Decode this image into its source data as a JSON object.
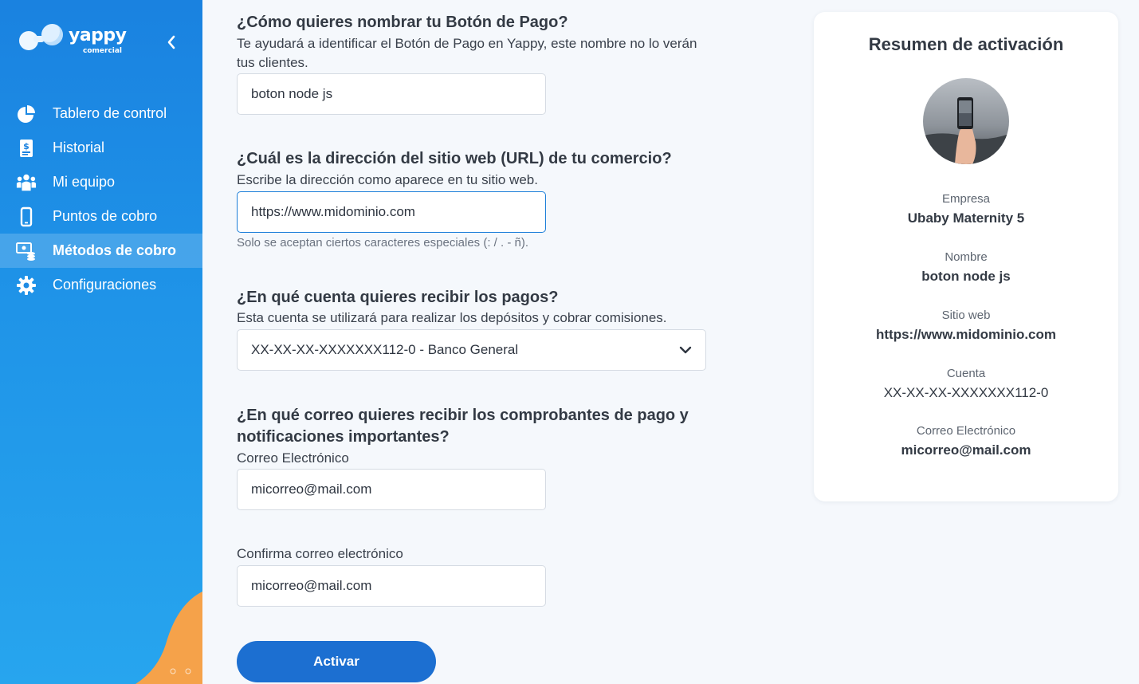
{
  "brand": {
    "name": "yappy",
    "sub": "comercial"
  },
  "sidebar": {
    "items": [
      {
        "label": "Tablero de control",
        "icon": "pie-chart-icon"
      },
      {
        "label": "Historial",
        "icon": "receipt-icon"
      },
      {
        "label": "Mi equipo",
        "icon": "team-icon"
      },
      {
        "label": "Puntos de cobro",
        "icon": "phone-icon"
      },
      {
        "label": "Métodos de cobro",
        "icon": "payment-methods-icon",
        "active": true
      },
      {
        "label": "Configuraciones",
        "icon": "gear-icon"
      }
    ]
  },
  "form": {
    "q1": {
      "title": "¿Cómo quieres nombrar tu Botón de Pago?",
      "desc_line1": "Te ayudará a identificar el Botón de Pago en Yappy, este nombre no lo verán",
      "desc_line2": "tus clientes.",
      "value": "boton node js"
    },
    "q2": {
      "title": "¿Cuál es la dirección del sitio web (URL) de tu comercio?",
      "desc": "Escribe la dirección como aparece en tu sitio web.",
      "value": "https://www.midominio.com",
      "hint": "Solo se aceptan ciertos caracteres especiales (: / . - ñ)."
    },
    "q3": {
      "title": "¿En qué cuenta quieres recibir los pagos?",
      "desc": "Esta cuenta se utilizará para realizar los depósitos y cobrar comisiones.",
      "selected": "XX-XX-XX-XXXXXXX112-0 - Banco General"
    },
    "q4": {
      "title_line1": "¿En qué correo quieres recibir los comprobantes de pago y",
      "title_line2": "notificaciones importantes?",
      "email_label": "Correo Electrónico",
      "email_value": "micorreo@mail.com",
      "confirm_label": "Confirma correo electrónico",
      "confirm_value": "micorreo@mail.com"
    },
    "submit_label": "Activar"
  },
  "summary": {
    "title": "Resumen de activación",
    "company_label": "Empresa",
    "company_value": "Ubaby Maternity 5",
    "name_label": "Nombre",
    "name_value": "boton node js",
    "site_label": "Sitio web",
    "site_value": "https://www.midominio.com",
    "account_label": "Cuenta",
    "account_value": "XX-XX-XX-XXXXXXX112-0",
    "email_label": "Correo Electrónico",
    "email_value": "micorreo@mail.com"
  },
  "colors": {
    "sidebar": "#1a82e0",
    "accent": "#1c6fd1",
    "orange": "#f5a24a"
  }
}
